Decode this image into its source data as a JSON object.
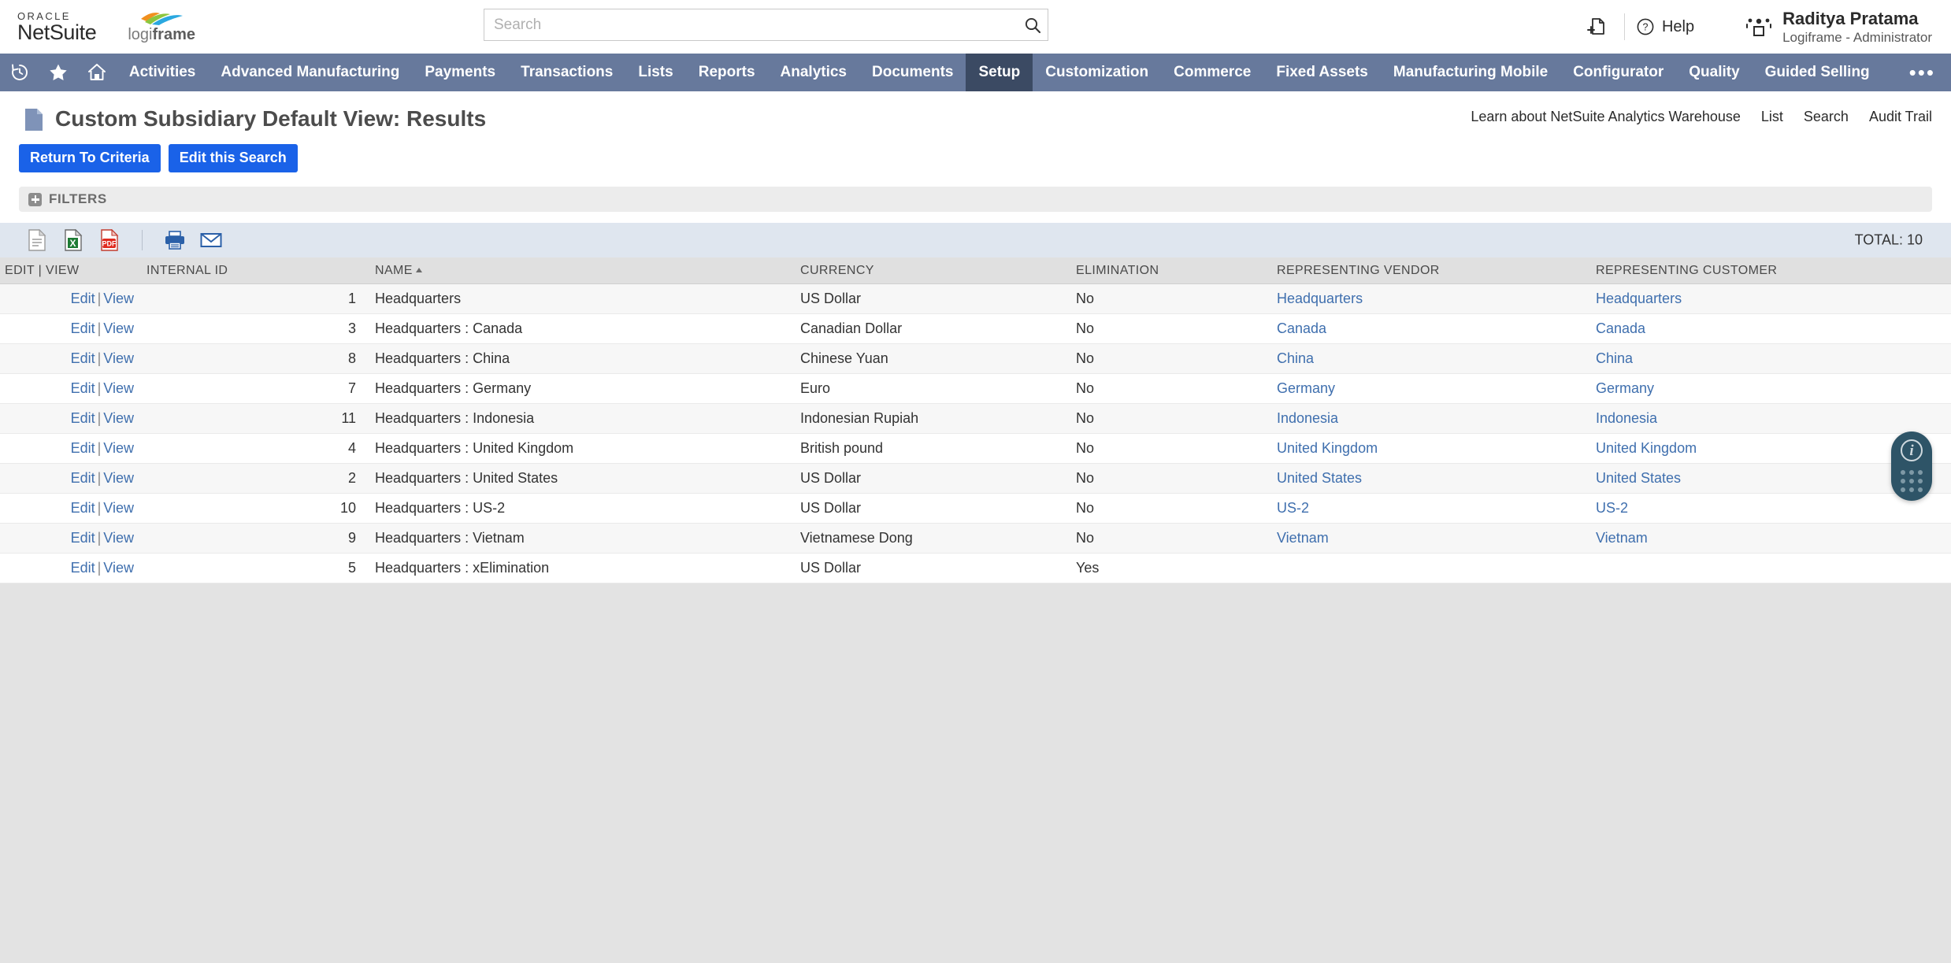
{
  "header": {
    "oracle_word": "ORACLE",
    "netsuite_word": "NetSuite",
    "partner_logo_text_light": "logi",
    "partner_logo_text_bold": "frame",
    "search_placeholder": "Search",
    "search_value": "",
    "add_page_icon": "add-page-icon",
    "help_label": "Help",
    "help_icon": "question-circle-icon",
    "user_icon": "people-group-icon",
    "user_name": "Raditya Pratama",
    "user_role": "Logiframe - Administrator"
  },
  "nav": {
    "icons": [
      "recent-history-icon",
      "star-favorites-icon",
      "home-icon"
    ],
    "items": [
      {
        "label": "Activities",
        "active": false
      },
      {
        "label": "Advanced Manufacturing",
        "active": false
      },
      {
        "label": "Payments",
        "active": false
      },
      {
        "label": "Transactions",
        "active": false
      },
      {
        "label": "Lists",
        "active": false
      },
      {
        "label": "Reports",
        "active": false
      },
      {
        "label": "Analytics",
        "active": false
      },
      {
        "label": "Documents",
        "active": false
      },
      {
        "label": "Setup",
        "active": true
      },
      {
        "label": "Customization",
        "active": false
      },
      {
        "label": "Commerce",
        "active": false
      },
      {
        "label": "Fixed Assets",
        "active": false
      },
      {
        "label": "Manufacturing Mobile",
        "active": false
      },
      {
        "label": "Configurator",
        "active": false
      },
      {
        "label": "Quality",
        "active": false
      },
      {
        "label": "Guided Selling",
        "active": false
      }
    ],
    "more_label": "•••"
  },
  "page": {
    "title": "Custom Subsidiary Default View: Results",
    "title_icon": "document-icon",
    "links": [
      {
        "label": "Learn about NetSuite Analytics Warehouse"
      },
      {
        "label": "List"
      },
      {
        "label": "Search"
      },
      {
        "label": "Audit Trail"
      }
    ],
    "buttons": [
      {
        "label": "Return To Criteria"
      },
      {
        "label": "Edit this Search"
      }
    ],
    "filters_label": "FILTERS"
  },
  "toolbar": {
    "icons": [
      "csv-export-icon",
      "excel-export-icon",
      "pdf-export-icon",
      "print-icon",
      "email-icon"
    ],
    "total_label": "TOTAL: 10"
  },
  "table": {
    "columns": [
      {
        "label": "EDIT | VIEW",
        "key": "edit",
        "sorted": false
      },
      {
        "label": "INTERNAL ID",
        "key": "id",
        "sorted": false
      },
      {
        "label": "NAME",
        "key": "name",
        "sorted": true,
        "sort_dir": "asc"
      },
      {
        "label": "CURRENCY",
        "key": "currency",
        "sorted": false
      },
      {
        "label": "ELIMINATION",
        "key": "elimination",
        "sorted": false
      },
      {
        "label": "REPRESENTING VENDOR",
        "key": "vendor",
        "sorted": false
      },
      {
        "label": "REPRESENTING CUSTOMER",
        "key": "customer",
        "sorted": false
      }
    ],
    "edit_label": "Edit",
    "view_label": "View",
    "rows": [
      {
        "id": "1",
        "name": "Headquarters",
        "currency": "US Dollar",
        "elimination": "No",
        "vendor": "Headquarters",
        "customer": "Headquarters"
      },
      {
        "id": "3",
        "name": "Headquarters : Canada",
        "currency": "Canadian Dollar",
        "elimination": "No",
        "vendor": "Canada",
        "customer": "Canada"
      },
      {
        "id": "8",
        "name": "Headquarters : China",
        "currency": "Chinese Yuan",
        "elimination": "No",
        "vendor": "China",
        "customer": "China"
      },
      {
        "id": "7",
        "name": "Headquarters : Germany",
        "currency": "Euro",
        "elimination": "No",
        "vendor": "Germany",
        "customer": "Germany"
      },
      {
        "id": "11",
        "name": "Headquarters : Indonesia",
        "currency": "Indonesian Rupiah",
        "elimination": "No",
        "vendor": "Indonesia",
        "customer": "Indonesia"
      },
      {
        "id": "4",
        "name": "Headquarters : United Kingdom",
        "currency": "British pound",
        "elimination": "No",
        "vendor": "United Kingdom",
        "customer": "United Kingdom"
      },
      {
        "id": "2",
        "name": "Headquarters : United States",
        "currency": "US Dollar",
        "elimination": "No",
        "vendor": "United States",
        "customer": "United States"
      },
      {
        "id": "10",
        "name": "Headquarters : US-2",
        "currency": "US Dollar",
        "elimination": "No",
        "vendor": "US-2",
        "customer": "US-2"
      },
      {
        "id": "9",
        "name": "Headquarters : Vietnam",
        "currency": "Vietnamese Dong",
        "elimination": "No",
        "vendor": "Vietnam",
        "customer": "Vietnam"
      },
      {
        "id": "5",
        "name": "Headquarters : xElimination",
        "currency": "US Dollar",
        "elimination": "Yes",
        "vendor": "",
        "customer": ""
      }
    ]
  },
  "float_widget": {
    "info_glyph": "i",
    "info_icon": "info-circle-icon",
    "grid_icon": "dot-grid-icon"
  },
  "colors": {
    "nav_bg": "#67799c",
    "nav_active_bg": "#3b4a63",
    "button_blue": "#1a62e8",
    "link_blue": "#3f6fae",
    "toolbar_bg": "#dfe6ef",
    "page_bg": "#e3e3e3",
    "widget_bg": "#2e5467"
  }
}
